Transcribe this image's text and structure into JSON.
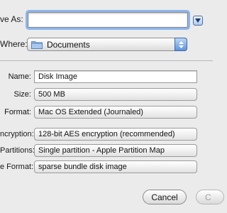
{
  "save_as": {
    "label": "ve As:",
    "value": ""
  },
  "where": {
    "label": "Where:",
    "value": "Documents",
    "icon": "folder-icon"
  },
  "form": {
    "name": {
      "label": "Name:",
      "value": "Disk Image"
    },
    "size": {
      "label": "Size:",
      "value": "500 MB"
    },
    "format": {
      "label": "Format:",
      "value": "Mac OS Extended (Journaled)"
    },
    "encryption": {
      "label": "ncryption:",
      "value": "128-bit AES encryption (recommended)"
    },
    "partitions": {
      "label": "Partitions:",
      "value": "Single partition - Apple Partition Map"
    },
    "image_format": {
      "label": "e Format:",
      "value": "sparse bundle disk image"
    }
  },
  "buttons": {
    "cancel": "Cancel",
    "create": "C"
  },
  "colors": {
    "focus_ring": "#8cb6ec",
    "stepper_blue": "#5f93dc",
    "background": "#ebebeb"
  }
}
